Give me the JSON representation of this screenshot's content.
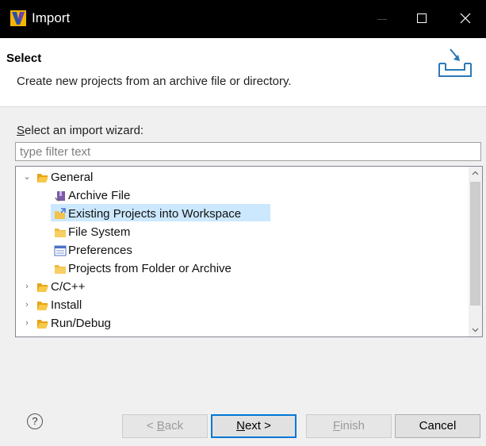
{
  "window": {
    "title": "Import"
  },
  "header": {
    "title": "Select",
    "description": "Create new projects from an archive file or directory."
  },
  "wizard": {
    "label_prefix": "S",
    "label_rest": "elect an import wizard:",
    "filter_placeholder": "type filter text",
    "tree": [
      {
        "label": "General",
        "expanded": true,
        "icon": "folder-open-icon"
      },
      {
        "label": "Archive File",
        "icon": "archive-icon"
      },
      {
        "label": "Existing Projects into Workspace",
        "icon": "projects-folder-icon",
        "selected": true
      },
      {
        "label": "File System",
        "icon": "folder-icon"
      },
      {
        "label": "Preferences",
        "icon": "preferences-icon"
      },
      {
        "label": "Projects from Folder or Archive",
        "icon": "folder-icon"
      },
      {
        "label": "C/C++",
        "expanded": false,
        "icon": "folder-open-icon"
      },
      {
        "label": "Install",
        "expanded": false,
        "icon": "folder-open-icon"
      },
      {
        "label": "Run/Debug",
        "expanded": false,
        "icon": "folder-open-icon"
      }
    ]
  },
  "footer": {
    "help_symbol": "?",
    "back": {
      "pre": "< ",
      "mnemonic": "B",
      "rest": "ack"
    },
    "next": {
      "mnemonic": "N",
      "rest": "ext >"
    },
    "finish": {
      "mnemonic": "F",
      "rest": "inish"
    },
    "cancel": "Cancel"
  },
  "colors": {
    "selection": "#cce8ff",
    "default_button_border": "#0078d7",
    "titlebar": "#000000"
  }
}
